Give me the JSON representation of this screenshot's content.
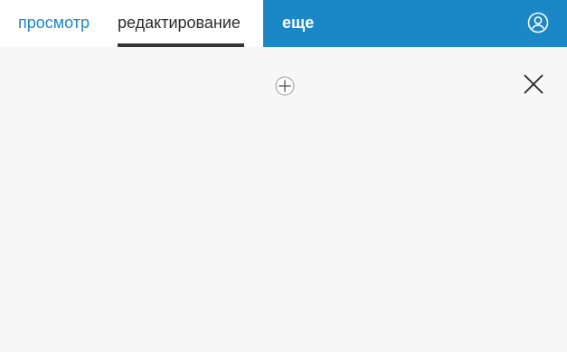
{
  "tabs": {
    "view_label": "просмотр",
    "edit_label": "редактирование",
    "active": "edit"
  },
  "more_label": "еще",
  "icons": {
    "account": "account-circle-icon",
    "add": "add-circle-icon",
    "close": "close-icon"
  },
  "colors": {
    "brand": "#1a87c6",
    "background": "#f7f7f7",
    "active_tab_underline": "#333333"
  }
}
